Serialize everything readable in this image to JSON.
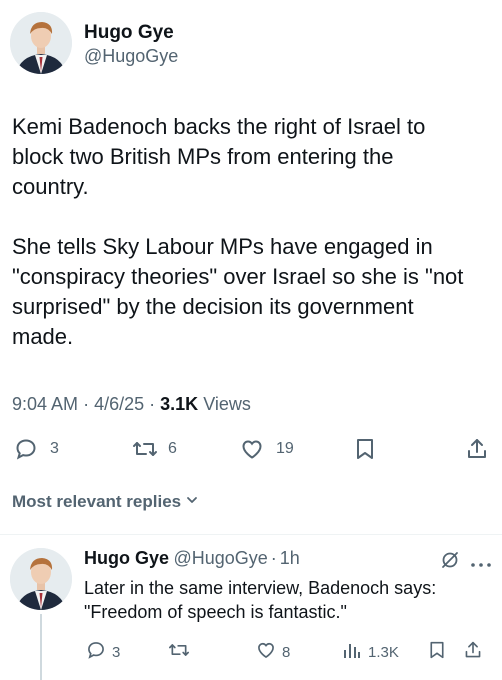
{
  "tweet": {
    "author_name": "Hugo Gye",
    "author_handle": "@HugoGye",
    "text_p1": "Kemi Badenoch backs the right of Israel to\nblock two British MPs from entering the\ncountry.",
    "text_p2": "She tells Sky Labour MPs have engaged in\n\"conspiracy theories\" over Israel so she is \"not\nsurprised\" by the decision its government\nmade.",
    "time": "9:04 AM",
    "date": "4/6/25",
    "separator": "·",
    "views_count": "3.1K",
    "views_label": "Views",
    "replies_count": "3",
    "reposts_count": "6",
    "likes_count": "19"
  },
  "replies_filter": {
    "label": "Most relevant replies"
  },
  "reply": {
    "author_name": "Hugo Gye",
    "author_handle": "@HugoGye",
    "separator": "·",
    "time_ago": "1h",
    "text": "Later in the same interview, Badenoch says:\n\"Freedom of speech is fantastic.\"",
    "replies_count": "3",
    "likes_count": "8",
    "views_count": "1.3K"
  },
  "colors": {
    "text": "#0f1419",
    "secondary": "#536471",
    "divider": "#eff3f4"
  },
  "icons": [
    "reply-icon",
    "repost-icon",
    "like-icon",
    "bookmark-icon",
    "share-icon",
    "views-icon",
    "chevron-down-icon",
    "grok-icon",
    "more-icon"
  ]
}
